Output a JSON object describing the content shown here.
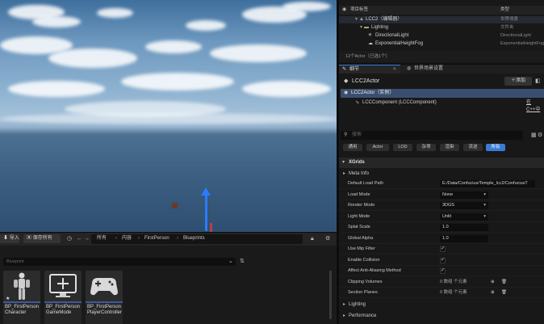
{
  "outliner": {
    "header_label": "项目标签",
    "header_type": "类型",
    "rows": [
      {
        "label": "LCC2（编辑器）",
        "type": "世界场景"
      },
      {
        "label": "Lighting",
        "type": "文件夹"
      },
      {
        "label": "DirectionalLight",
        "type": "DirectionalLight"
      },
      {
        "label": "ExponentialHeightFog",
        "type": "ExponentialHeightFog"
      }
    ],
    "status": "12个Actor（已选1个）"
  },
  "details_tabs": {
    "details": "细节",
    "world_settings": "世界场景设置"
  },
  "details": {
    "actor_name": "LCC2Actor",
    "add_label": "添加",
    "component_root": "LCC2Actor（实例）",
    "component_child": "LCCComponent (LCCComponent)",
    "component_child_suffix": "在C++中",
    "search_placeholder": "搜索",
    "filters": [
      "通用",
      "Actor",
      "LOD",
      "杂项",
      "渲染",
      "流送",
      "所有"
    ],
    "section": "XGrids",
    "meta_info": "Meta Info",
    "properties": [
      {
        "label": "Default Load Path",
        "value": "E:/Data/Confucius/Temple_lcc2/ConfuciusT",
        "kind": "text"
      },
      {
        "label": "Load Mode",
        "value": "None",
        "kind": "dropdown"
      },
      {
        "label": "Render Mode",
        "value": "3DGS",
        "kind": "dropdown"
      },
      {
        "label": "Light Mode",
        "value": "Unlit",
        "kind": "dropdown"
      },
      {
        "label": "Splat Scale",
        "value": "1.0",
        "kind": "number"
      },
      {
        "label": "Global Alpha",
        "value": "1.0",
        "kind": "number"
      },
      {
        "label": "Use Mip Filter",
        "value": "✓",
        "kind": "check"
      },
      {
        "label": "Enable Collision",
        "value": "✓",
        "kind": "check"
      },
      {
        "label": "Affect Anti-Aliasing Method",
        "value": "✓",
        "kind": "check"
      },
      {
        "label": "Clipping Volumes",
        "value": "0 数组 个元素",
        "kind": "array"
      },
      {
        "label": "Section Planes",
        "value": "0 数组 个元素",
        "kind": "array"
      }
    ],
    "sections_after": [
      "Lighting",
      "Performance"
    ]
  },
  "content_browser": {
    "import_label": "导入",
    "save_all_label": "保存所有",
    "breadcrumb": [
      "所有",
      "内容",
      "FirstPerson",
      "Blueprints"
    ],
    "search_placeholder": "Blueprint",
    "assets": [
      {
        "name": "BP_FirstPerson Character",
        "icon": "mannequin-icon"
      },
      {
        "name": "BP_FirstPerson GameMode",
        "icon": "monitor-icon"
      },
      {
        "name": "BP_FirstPerson PlayerController",
        "icon": "gamepad-icon"
      }
    ]
  },
  "colors": {
    "accent": "#3b7bd8",
    "selection": "#3a4f6f"
  }
}
